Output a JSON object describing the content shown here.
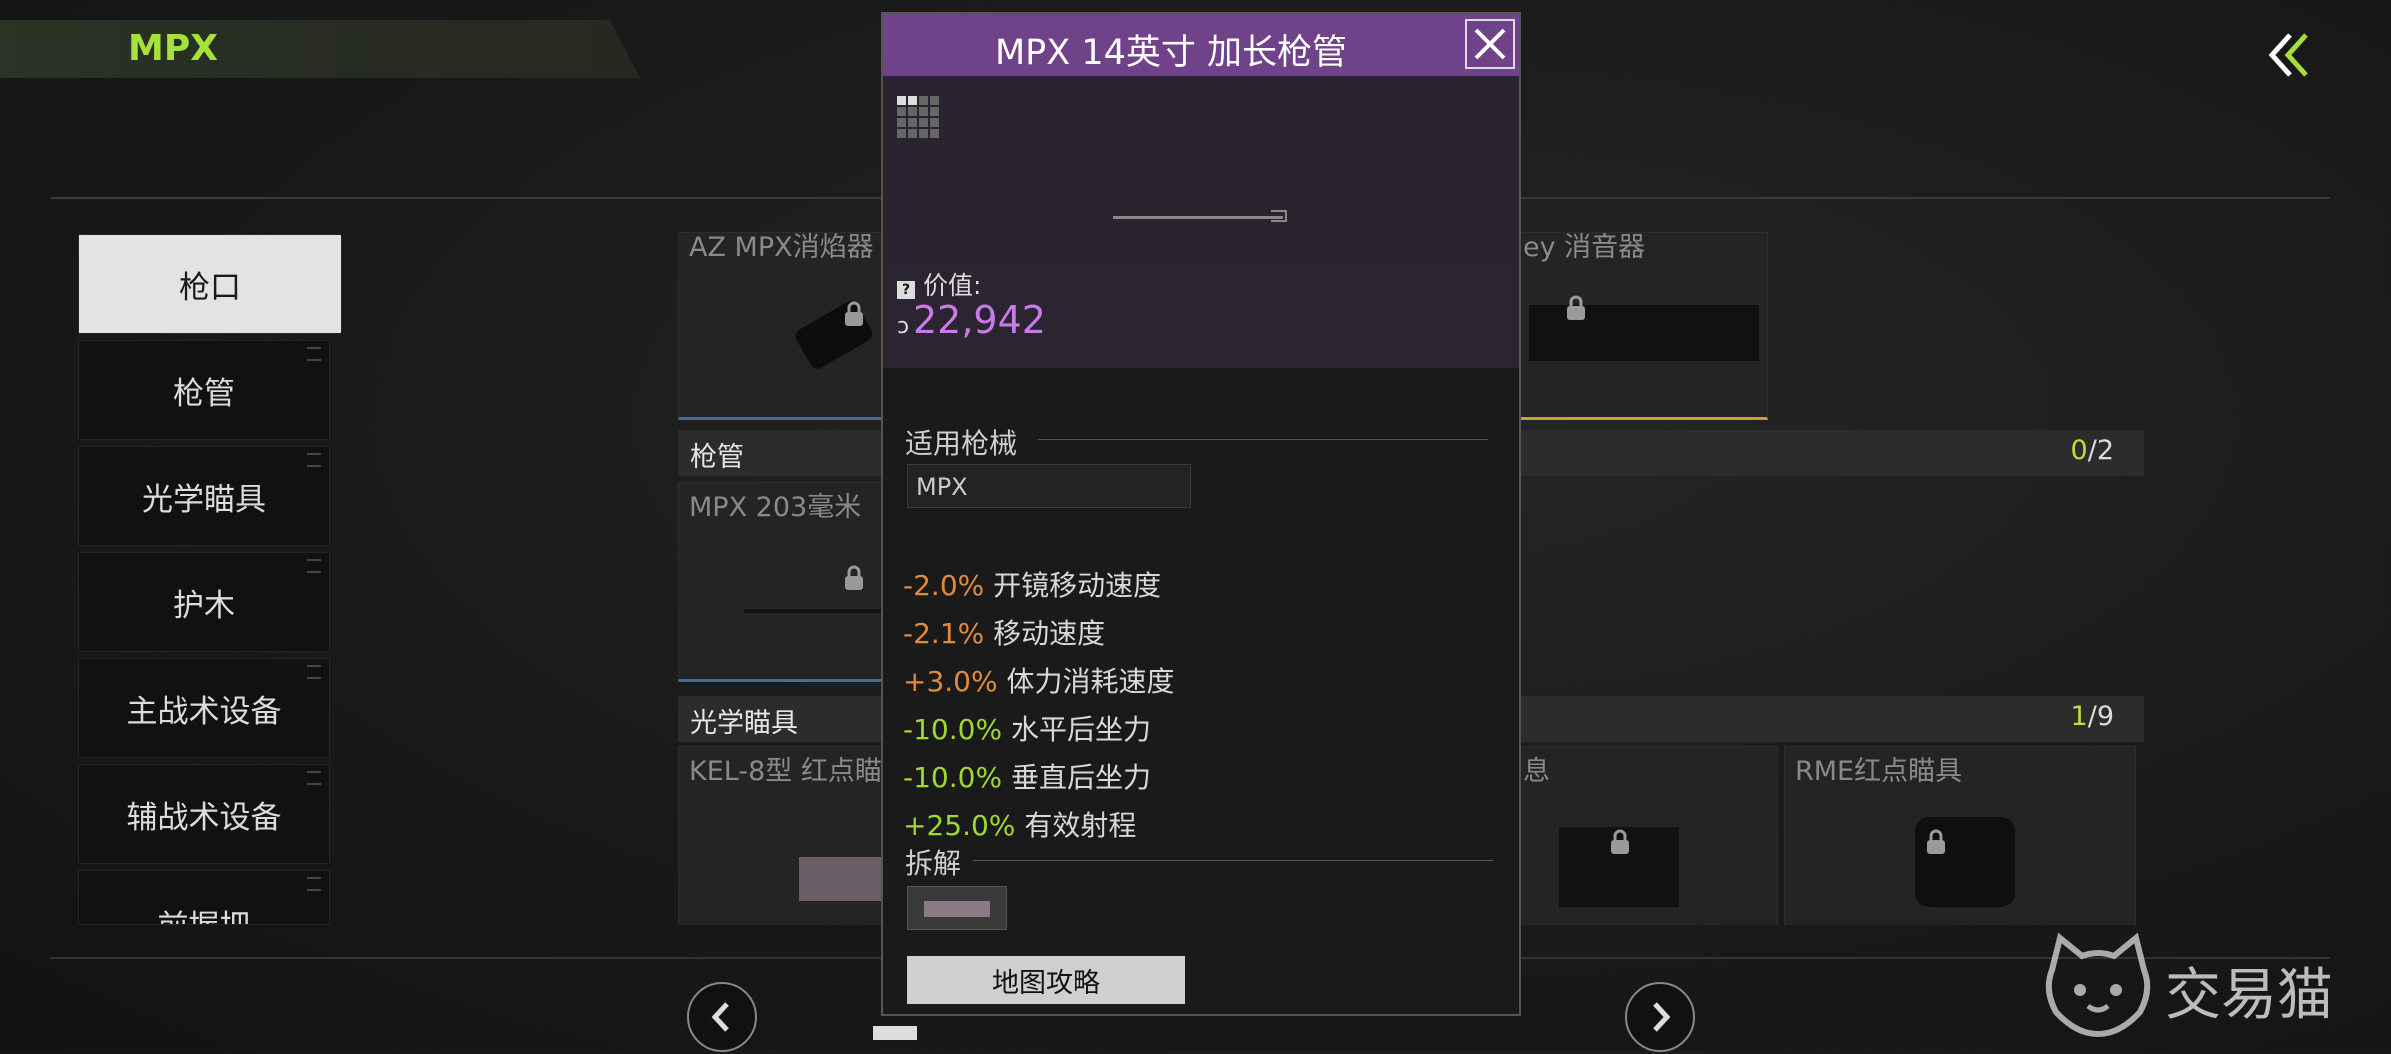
{
  "header": {
    "title": "MPX"
  },
  "sidebar": {
    "items": [
      {
        "label": "枪口"
      },
      {
        "label": "枪管"
      },
      {
        "label": "光学瞄具"
      },
      {
        "label": "护木"
      },
      {
        "label": "主战术设备"
      },
      {
        "label": "辅战术设备"
      },
      {
        "label": "前握把"
      }
    ]
  },
  "grid": {
    "muzzle_cards": [
      {
        "title": "AZ MPX消焰器"
      },
      {
        "title": "ey 消音器"
      }
    ],
    "barrel": {
      "header": "枪管",
      "count_current": "0",
      "count_total": "/2",
      "cards": [
        {
          "title": "MPX 203毫米"
        }
      ]
    },
    "optics": {
      "header": "光学瞄具",
      "count_current": "1",
      "count_total": "/9",
      "cards": [
        {
          "title": "KEL-8型 红点瞄"
        },
        {
          "title": "息"
        },
        {
          "title": "RME红点瞄具"
        }
      ]
    }
  },
  "popup": {
    "title": "MPX 14英寸 加长枪管",
    "value_label": "价值:",
    "value": "22,942",
    "compat_title": "适用枪械",
    "compat_weapon": "MPX",
    "stats": [
      {
        "delta": "-2.0%",
        "name": "开镜移动速度",
        "tone": "neg"
      },
      {
        "delta": "-2.1%",
        "name": "移动速度",
        "tone": "neg"
      },
      {
        "delta": "+3.0%",
        "name": "体力消耗速度",
        "tone": "neg"
      },
      {
        "delta": "-10.0%",
        "name": "水平后坐力",
        "tone": "pos"
      },
      {
        "delta": "-10.0%",
        "name": "垂直后坐力",
        "tone": "pos"
      },
      {
        "delta": "+25.0%",
        "name": "有效射程",
        "tone": "pos"
      }
    ],
    "disassemble_title": "拆解",
    "guide_button": "地图攻略"
  },
  "watermark": {
    "text": "交易猫"
  },
  "colors": {
    "accent_green": "#a4e23b",
    "popup_purple": "#6f4289",
    "value_purple": "#c87ae8",
    "negative": "#e28a3a",
    "positive": "#9fd82e"
  }
}
